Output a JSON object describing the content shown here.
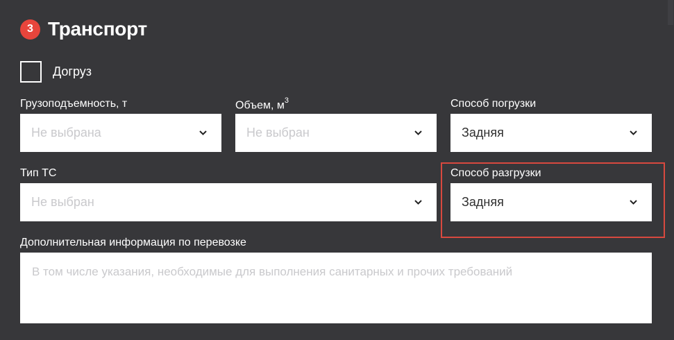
{
  "section": {
    "step_number": "3",
    "title": "Транспорт"
  },
  "reload_checkbox": {
    "label": "Догруз",
    "checked": false
  },
  "fields": {
    "capacity": {
      "label": "Грузоподъемность, т",
      "placeholder": "Не выбрана"
    },
    "volume": {
      "label": "Объем, м",
      "label_superscript": "3",
      "placeholder": "Не выбран"
    },
    "loading_method": {
      "label": "Способ погрузки",
      "value": "Задняя"
    },
    "vehicle_type": {
      "label": "Тип ТС",
      "placeholder": "Не выбран"
    },
    "unloading_method": {
      "label": "Способ разгрузки",
      "value": "Задняя"
    },
    "additional_info": {
      "label": "Дополнительная информация по перевозке",
      "placeholder": "В том числе указания, необходимые для выполнения санитарных и прочих требований"
    }
  },
  "colors": {
    "background": "#37373a",
    "accent": "#e8453c",
    "highlight_border": "#d9493f"
  },
  "icons": {
    "dropdown": "chevron-down-icon"
  }
}
